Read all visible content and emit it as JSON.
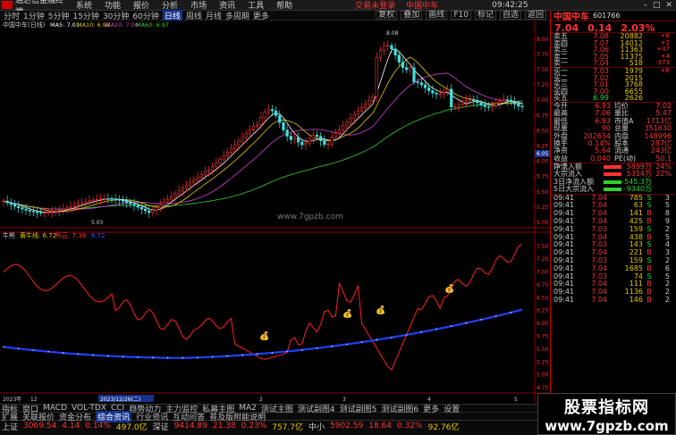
{
  "titlebar": {
    "app": "通达信金融终端",
    "menu": [
      "系统",
      "功能",
      "报价",
      "分析",
      "市场",
      "资讯",
      "工具",
      "帮助"
    ],
    "menu2": [
      "交易",
      "行业",
      "L1L2"
    ],
    "center": [
      "交易未登录",
      "中国中车"
    ],
    "clock": "09:42:25",
    "window": [
      "行情",
      "资讯",
      "交易",
      "服务"
    ]
  },
  "toolbar": {
    "periods": [
      "分时",
      "1分钟",
      "5分钟",
      "15分钟",
      "30分钟",
      "60分钟",
      "日线",
      "周线",
      "月线",
      "多周期",
      "更多"
    ],
    "active": "日线",
    "tools": [
      "复权",
      "叠加",
      "画线",
      "F10",
      "标记",
      "自选",
      "返回"
    ]
  },
  "main_chart": {
    "title": "中国中车(日线)",
    "ma_labels": [
      {
        "text": "MA5: 7.01",
        "color": "#ffffff"
      },
      {
        "text": "MA10: 6.98",
        "color": "#e6c800"
      },
      {
        "text": "MA20: 7.06",
        "color": "#d040d0"
      },
      {
        "text": "MA60: 6.97",
        "color": "#2fd02f"
      }
    ],
    "yaxis": [
      "8.00",
      "7.75",
      "7.50",
      "7.25",
      "7.00",
      "6.75",
      "6.50",
      "6.25",
      "6.00",
      "5.75",
      "5.50",
      "5.25",
      "5.00"
    ],
    "high_label": "8.08",
    "low_label": "5.03",
    "cursor_price": "6.05",
    "watermark": "www.7gpzb.com"
  },
  "indicator": {
    "title": "牛熊",
    "line1": "黄牛线: 6.72",
    "line2": "熊云: 7.38",
    "line3": "6.72",
    "yaxis": [
      "7.50",
      "7.25",
      "7.00",
      "6.75",
      "6.50",
      "6.25",
      "6.00",
      "5.75",
      "5.50",
      "5.25",
      "5.00",
      "4.75"
    ],
    "icons": [
      "money-bag",
      "money-bag",
      "money-bag",
      "money-bag"
    ]
  },
  "xaxis": {
    "labels": [
      "2023年",
      "12",
      "2023/12/26(二)",
      "2",
      "3",
      "4",
      "5"
    ]
  },
  "stock": {
    "name": "中国中车",
    "code": "601766",
    "price": "7.04",
    "change": "0.14",
    "pct": "2.03%"
  },
  "order_book": {
    "asks": [
      {
        "label": "卖五",
        "price": "7.08",
        "vol": "20882",
        "chg": "+6"
      },
      {
        "label": "卖四",
        "price": "7.07",
        "vol": "14012",
        "chg": "+2"
      },
      {
        "label": "卖三",
        "price": "7.06",
        "vol": "11363",
        "chg": "+47"
      },
      {
        "label": "卖二",
        "price": "7.05",
        "vol": "11375",
        "chg": "+4"
      },
      {
        "label": "卖一",
        "price": "7.04",
        "vol": "518",
        "chg": "-373"
      }
    ],
    "bids": [
      {
        "label": "买一",
        "price": "7.03",
        "vol": "1979",
        "chg": "+6"
      },
      {
        "label": "买二",
        "price": "7.02",
        "vol": "2015",
        "chg": ""
      },
      {
        "label": "买三",
        "price": "7.01",
        "vol": "3768",
        "chg": ""
      },
      {
        "label": "买四",
        "price": "7.00",
        "vol": "6655",
        "chg": ""
      },
      {
        "label": "买五",
        "price": "6.99",
        "vol": "2626",
        "chg": ""
      }
    ]
  },
  "stats": [
    {
      "k": "今开",
      "v1": "6.93",
      "k2": "均价",
      "v2": "7.02"
    },
    {
      "k": "最高",
      "v1": "7.06",
      "k2": "量比",
      "v2": "5.47"
    },
    {
      "k": "最低",
      "v1": "6.93",
      "k2": "市值A",
      "v2": "1713亿"
    },
    {
      "k": "现量",
      "v1": "90",
      "k2": "总量",
      "v2": "351630"
    },
    {
      "k": "外盘",
      "v1": "202634",
      "k2": "内盘",
      "v2": "148996"
    },
    {
      "k": "换手",
      "v1": "0.14%",
      "k2": "股本",
      "v2": "287亿"
    },
    {
      "k": "净资",
      "v1": "5.64",
      "k2": "流通",
      "v2": "243亿"
    },
    {
      "k": "收益(一)",
      "v1": "0.040",
      "k2": "PE(动)",
      "v2": "50.1"
    }
  ],
  "flows": [
    {
      "k": "净流入额",
      "v": "5899万",
      "pct": "24%",
      "color": "#ff3333"
    },
    {
      "k": "大宗流入",
      "v": "5314万",
      "pct": "22%",
      "color": "#ff3333"
    },
    {
      "k": "3日净流入额",
      "v": "-545.3万",
      "pct": "",
      "color": "#2fd02f"
    },
    {
      "k": "5日大宗流入",
      "v": "-9340万",
      "pct": "",
      "color": "#2fd02f"
    }
  ],
  "ticks": [
    {
      "t": "09:41",
      "p": "7.04",
      "v": "785",
      "d": "S",
      "n": "3"
    },
    {
      "t": "09:41",
      "p": "7.04",
      "v": "63",
      "d": "S",
      "n": "5"
    },
    {
      "t": "09:41",
      "p": "7.04",
      "v": "141",
      "d": "B",
      "n": "8"
    },
    {
      "t": "09:41",
      "p": "7.04",
      "v": "425",
      "d": "B",
      "n": "9"
    },
    {
      "t": "09:41",
      "p": "7.03",
      "v": "159",
      "d": "S",
      "n": "2"
    },
    {
      "t": "09:41",
      "p": "7.04",
      "v": "438",
      "d": "B",
      "n": "5"
    },
    {
      "t": "09:41",
      "p": "7.03",
      "v": "143",
      "d": "S",
      "n": "4"
    },
    {
      "t": "09:41",
      "p": "7.04",
      "v": "221",
      "d": "B",
      "n": "3"
    },
    {
      "t": "09:41",
      "p": "7.03",
      "v": "159",
      "d": "S",
      "n": "2"
    },
    {
      "t": "09:41",
      "p": "7.04",
      "v": "1685",
      "d": "B",
      "n": "6"
    },
    {
      "t": "09:41",
      "p": "7.03",
      "v": "74",
      "d": "S",
      "n": "5"
    },
    {
      "t": "09:41",
      "p": "7.04",
      "v": "111",
      "d": "B",
      "n": "2"
    },
    {
      "t": "09:41",
      "p": "7.04",
      "v": "1136",
      "d": "B",
      "n": "2"
    },
    {
      "t": "09:41",
      "p": "7.04",
      "v": "146",
      "d": "B",
      "n": "2"
    }
  ],
  "bottom": {
    "tabs1": [
      "指标",
      "窗口",
      "MACD",
      "VOL-TDX",
      "CCI",
      "趋势动力",
      "主力监控",
      "私募主图",
      "MA2",
      "测试主图",
      "测试副图4",
      "测试副图5",
      "测试副图6",
      "更多",
      "设置"
    ],
    "tabs2": [
      "扩展",
      "关联报价",
      "资金分布",
      "综合资讯",
      "行业资讯",
      "互动问答",
      "普及版附能说明"
    ],
    "index": [
      {
        "name": "上证",
        "val": "3069.54",
        "chg": "4.14",
        "pct": "0.14%",
        "amt": "497.0亿"
      },
      {
        "name": "深证",
        "val": "9414.89",
        "chg": "21.38",
        "pct": "0.23%",
        "amt": "757.7亿"
      },
      {
        "name": "中小",
        "val": "5902.59",
        "chg": "18.64",
        "pct": "0.32%",
        "amt": "92.76亿"
      }
    ]
  },
  "watermark_box": {
    "line1": "股票指标网",
    "line2": "www.7gpzb.com"
  }
}
